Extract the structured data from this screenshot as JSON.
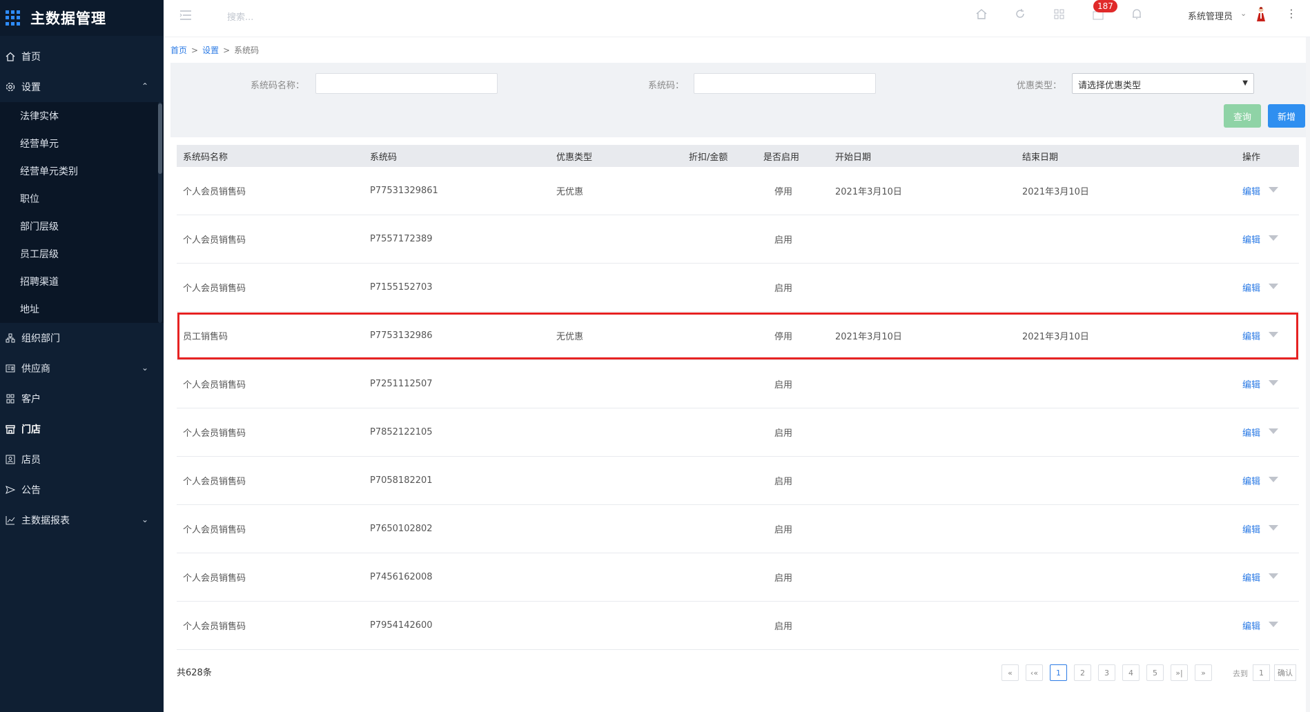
{
  "app": {
    "title": "主数据管理",
    "brand_color": "#2e8cff",
    "sidebar_bg": "#0f1f33"
  },
  "sidebar": {
    "items": [
      {
        "label": "首页",
        "icon": "home-icon"
      },
      {
        "label": "设置",
        "icon": "gear-icon",
        "expanded": true
      },
      {
        "label": "组织部门",
        "icon": "org-icon"
      },
      {
        "label": "供应商",
        "icon": "supplier-icon"
      },
      {
        "label": "客户",
        "icon": "customer-icon"
      },
      {
        "label": "门店",
        "icon": "store-icon"
      },
      {
        "label": "店员",
        "icon": "clerk-icon"
      },
      {
        "label": "公告",
        "icon": "notice-icon"
      },
      {
        "label": "主数据报表",
        "icon": "chart-icon"
      }
    ],
    "settings_children": [
      "法律实体",
      "经营单元",
      "经营单元类别",
      "职位",
      "部门层级",
      "员工层级",
      "招聘渠道",
      "地址"
    ]
  },
  "topbar": {
    "search_placeholder": "搜索...",
    "badge_count": "187",
    "user_name": "系统管理员",
    "icons": [
      "menu-icon",
      "home-icon",
      "refresh-icon",
      "grid-icon",
      "message-icon",
      "bell-icon"
    ]
  },
  "breadcrumb": {
    "home": "首页",
    "settings": "设置",
    "current": "系统码",
    "sep": ">"
  },
  "filter": {
    "name_label": "系统码名称：",
    "code_label": "系统码：",
    "type_label": "优惠类型：",
    "type_selected": "请选择优惠类型",
    "query_button": "查询",
    "new_button": "新增",
    "query_color": "#8fd3a6",
    "new_color": "#2f8ff0"
  },
  "table": {
    "headers": [
      "系统码名称",
      "系统码",
      "优惠类型",
      "折扣/金额",
      "是否启用",
      "开始日期",
      "结束日期",
      "操作"
    ],
    "edit_label": "编辑",
    "rows": [
      {
        "name": "个人会员销售码",
        "code": "P77531329861",
        "type": "无优惠",
        "amount": "",
        "enabled": "停用",
        "start": "2021年3月10日",
        "end": "2021年3月10日"
      },
      {
        "name": "个人会员销售码",
        "code": "P7557172389",
        "type": "",
        "amount": "",
        "enabled": "启用",
        "start": "",
        "end": ""
      },
      {
        "name": "个人会员销售码",
        "code": "P7155152703",
        "type": "",
        "amount": "",
        "enabled": "启用",
        "start": "",
        "end": ""
      },
      {
        "name": "员工销售码",
        "code": "P7753132986",
        "type": "无优惠",
        "amount": "",
        "enabled": "停用",
        "start": "2021年3月10日",
        "end": "2021年3月10日"
      },
      {
        "name": "个人会员销售码",
        "code": "P7251112507",
        "type": "",
        "amount": "",
        "enabled": "启用",
        "start": "",
        "end": ""
      },
      {
        "name": "个人会员销售码",
        "code": "P7852122105",
        "type": "",
        "amount": "",
        "enabled": "启用",
        "start": "",
        "end": ""
      },
      {
        "name": "个人会员销售码",
        "code": "P7058182201",
        "type": "",
        "amount": "",
        "enabled": "启用",
        "start": "",
        "end": ""
      },
      {
        "name": "个人会员销售码",
        "code": "P7650102802",
        "type": "",
        "amount": "",
        "enabled": "启用",
        "start": "",
        "end": ""
      },
      {
        "name": "个人会员销售码",
        "code": "P7456162008",
        "type": "",
        "amount": "",
        "enabled": "启用",
        "start": "",
        "end": ""
      },
      {
        "name": "个人会员销售码",
        "code": "P7954142600",
        "type": "",
        "amount": "",
        "enabled": "启用",
        "start": "",
        "end": ""
      }
    ],
    "highlight_color": "#e62222"
  },
  "footer": {
    "total": "共628条",
    "pages": [
      "«",
      "‹«",
      "1",
      "2",
      "3",
      "4",
      "5",
      "»|",
      "»"
    ],
    "current_page": "1",
    "goto_label": "去到",
    "goto_value": "1",
    "confirm_label": "确认"
  }
}
